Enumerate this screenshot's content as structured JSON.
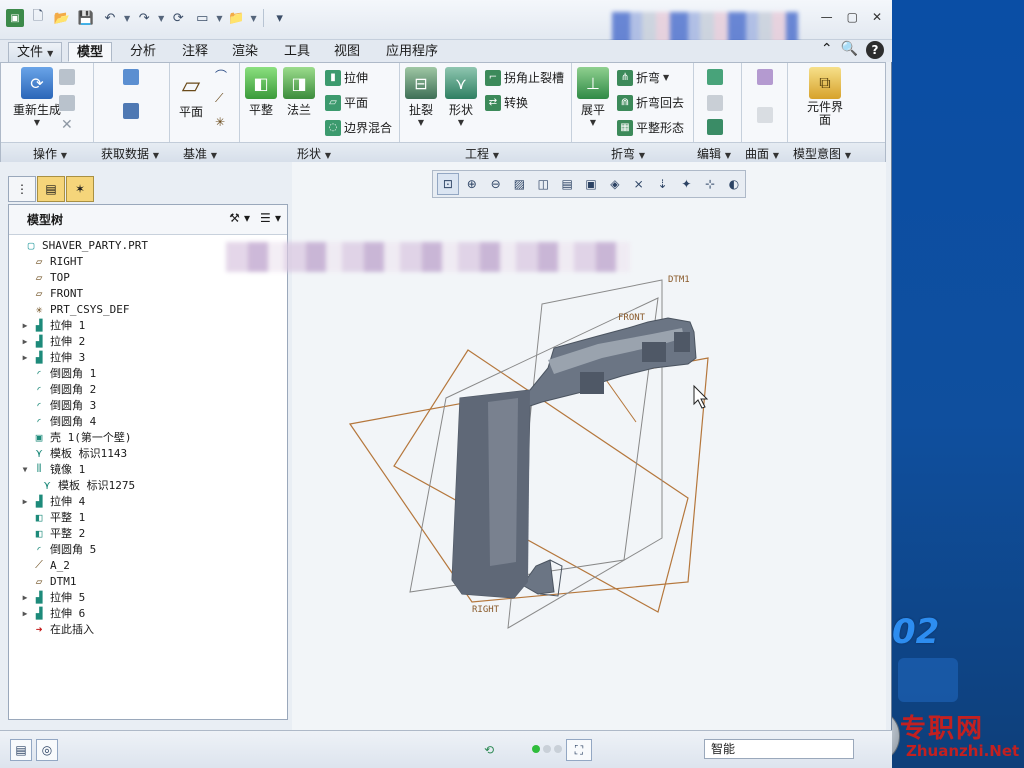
{
  "titlebar": {
    "qat_icons": [
      "app-icon",
      "new-file-icon",
      "open-folder-icon",
      "save-icon",
      "undo-icon",
      "redo-icon",
      "regenerate-icon",
      "window-icon",
      "folder-icon",
      "more-icon"
    ]
  },
  "menu": {
    "file": "文件",
    "tabs": [
      "模型",
      "分析",
      "注释",
      "渲染",
      "工具",
      "视图",
      "应用程序"
    ]
  },
  "ribbon": {
    "groups": {
      "operations": "操作",
      "get_data": "获取数据",
      "datum": "基准",
      "shapes": "形状",
      "engineering": "工程",
      "bend": "折弯",
      "edit": "编辑",
      "surface": "曲面",
      "model_intent": "模型意图"
    },
    "buttons": {
      "regenerate": "重新生成",
      "plane": "平面",
      "flatten": "平整",
      "flange": "法兰",
      "extrude": "拉伸",
      "plane_small": "平面",
      "boundary_blend": "边界混合",
      "rip": "扯裂",
      "form": "形状",
      "corner_relief": "拐角止裂槽",
      "convert": "转换",
      "unbend": "展平",
      "bend": "折弯",
      "bend_back": "折弯回去",
      "flat_state": "平整形态",
      "component_interface": "元件界面"
    }
  },
  "model_tree": {
    "title": "模型树",
    "items": [
      {
        "label": "SHAVER_PARTY.PRT",
        "icon": "part-icon",
        "expand": false,
        "indent": 0
      },
      {
        "label": "RIGHT",
        "icon": "datum-plane-icon",
        "expand": false,
        "indent": 1
      },
      {
        "label": "TOP",
        "icon": "datum-plane-icon",
        "expand": false,
        "indent": 1
      },
      {
        "label": "FRONT",
        "icon": "datum-plane-icon",
        "expand": false,
        "indent": 1
      },
      {
        "label": "PRT_CSYS_DEF",
        "icon": "csys-icon",
        "expand": false,
        "indent": 1
      },
      {
        "label": "拉伸 1",
        "icon": "extrude-icon",
        "expand": true,
        "indent": 1
      },
      {
        "label": "拉伸 2",
        "icon": "extrude-icon",
        "expand": true,
        "indent": 1
      },
      {
        "label": "拉伸 3",
        "icon": "extrude-icon",
        "expand": true,
        "indent": 1
      },
      {
        "label": "倒圆角 1",
        "icon": "round-icon",
        "expand": false,
        "indent": 1
      },
      {
        "label": "倒圆角 2",
        "icon": "round-icon",
        "expand": false,
        "indent": 1
      },
      {
        "label": "倒圆角 3",
        "icon": "round-icon",
        "expand": false,
        "indent": 1
      },
      {
        "label": "倒圆角 4",
        "icon": "round-icon",
        "expand": false,
        "indent": 1
      },
      {
        "label": "壳 1(第一个壁)",
        "icon": "shell-icon",
        "expand": false,
        "indent": 1
      },
      {
        "label": "模板 标识1143",
        "icon": "template-icon",
        "expand": false,
        "indent": 1
      },
      {
        "label": "镜像 1",
        "icon": "mirror-icon",
        "expand": "open",
        "indent": 1
      },
      {
        "label": "模板 标识1275",
        "icon": "template-icon",
        "expand": false,
        "indent": 2
      },
      {
        "label": "拉伸 4",
        "icon": "extrude-icon",
        "expand": true,
        "indent": 1
      },
      {
        "label": "平整 1",
        "icon": "flatten-icon",
        "expand": false,
        "indent": 1
      },
      {
        "label": "平整 2",
        "icon": "flatten-icon",
        "expand": false,
        "indent": 1
      },
      {
        "label": "倒圆角 5",
        "icon": "round-icon",
        "expand": false,
        "indent": 1
      },
      {
        "label": "A_2",
        "icon": "axis-icon",
        "expand": false,
        "indent": 1
      },
      {
        "label": "DTM1",
        "icon": "datum-plane-icon",
        "expand": false,
        "indent": 1
      },
      {
        "label": "拉伸 5",
        "icon": "extrude-icon",
        "expand": true,
        "indent": 1
      },
      {
        "label": "拉伸 6",
        "icon": "extrude-icon",
        "expand": true,
        "indent": 1
      },
      {
        "label": "在此插入",
        "icon": "insert-here-icon",
        "expand": false,
        "indent": 1
      }
    ]
  },
  "viewport": {
    "labels": {
      "dtm1": "DTM1",
      "front": "FRONT",
      "right": "RIGHT"
    }
  },
  "statusbar": {
    "filter": "智能"
  },
  "desktop": {
    "big_text": "02",
    "brand_cn": "专职网",
    "brand_en": "Zhuanzhi.Net"
  },
  "colors": {
    "datum_plane": "#b5773c",
    "model_grey": "#6b7584",
    "accent_green": "#2fbd3c"
  }
}
